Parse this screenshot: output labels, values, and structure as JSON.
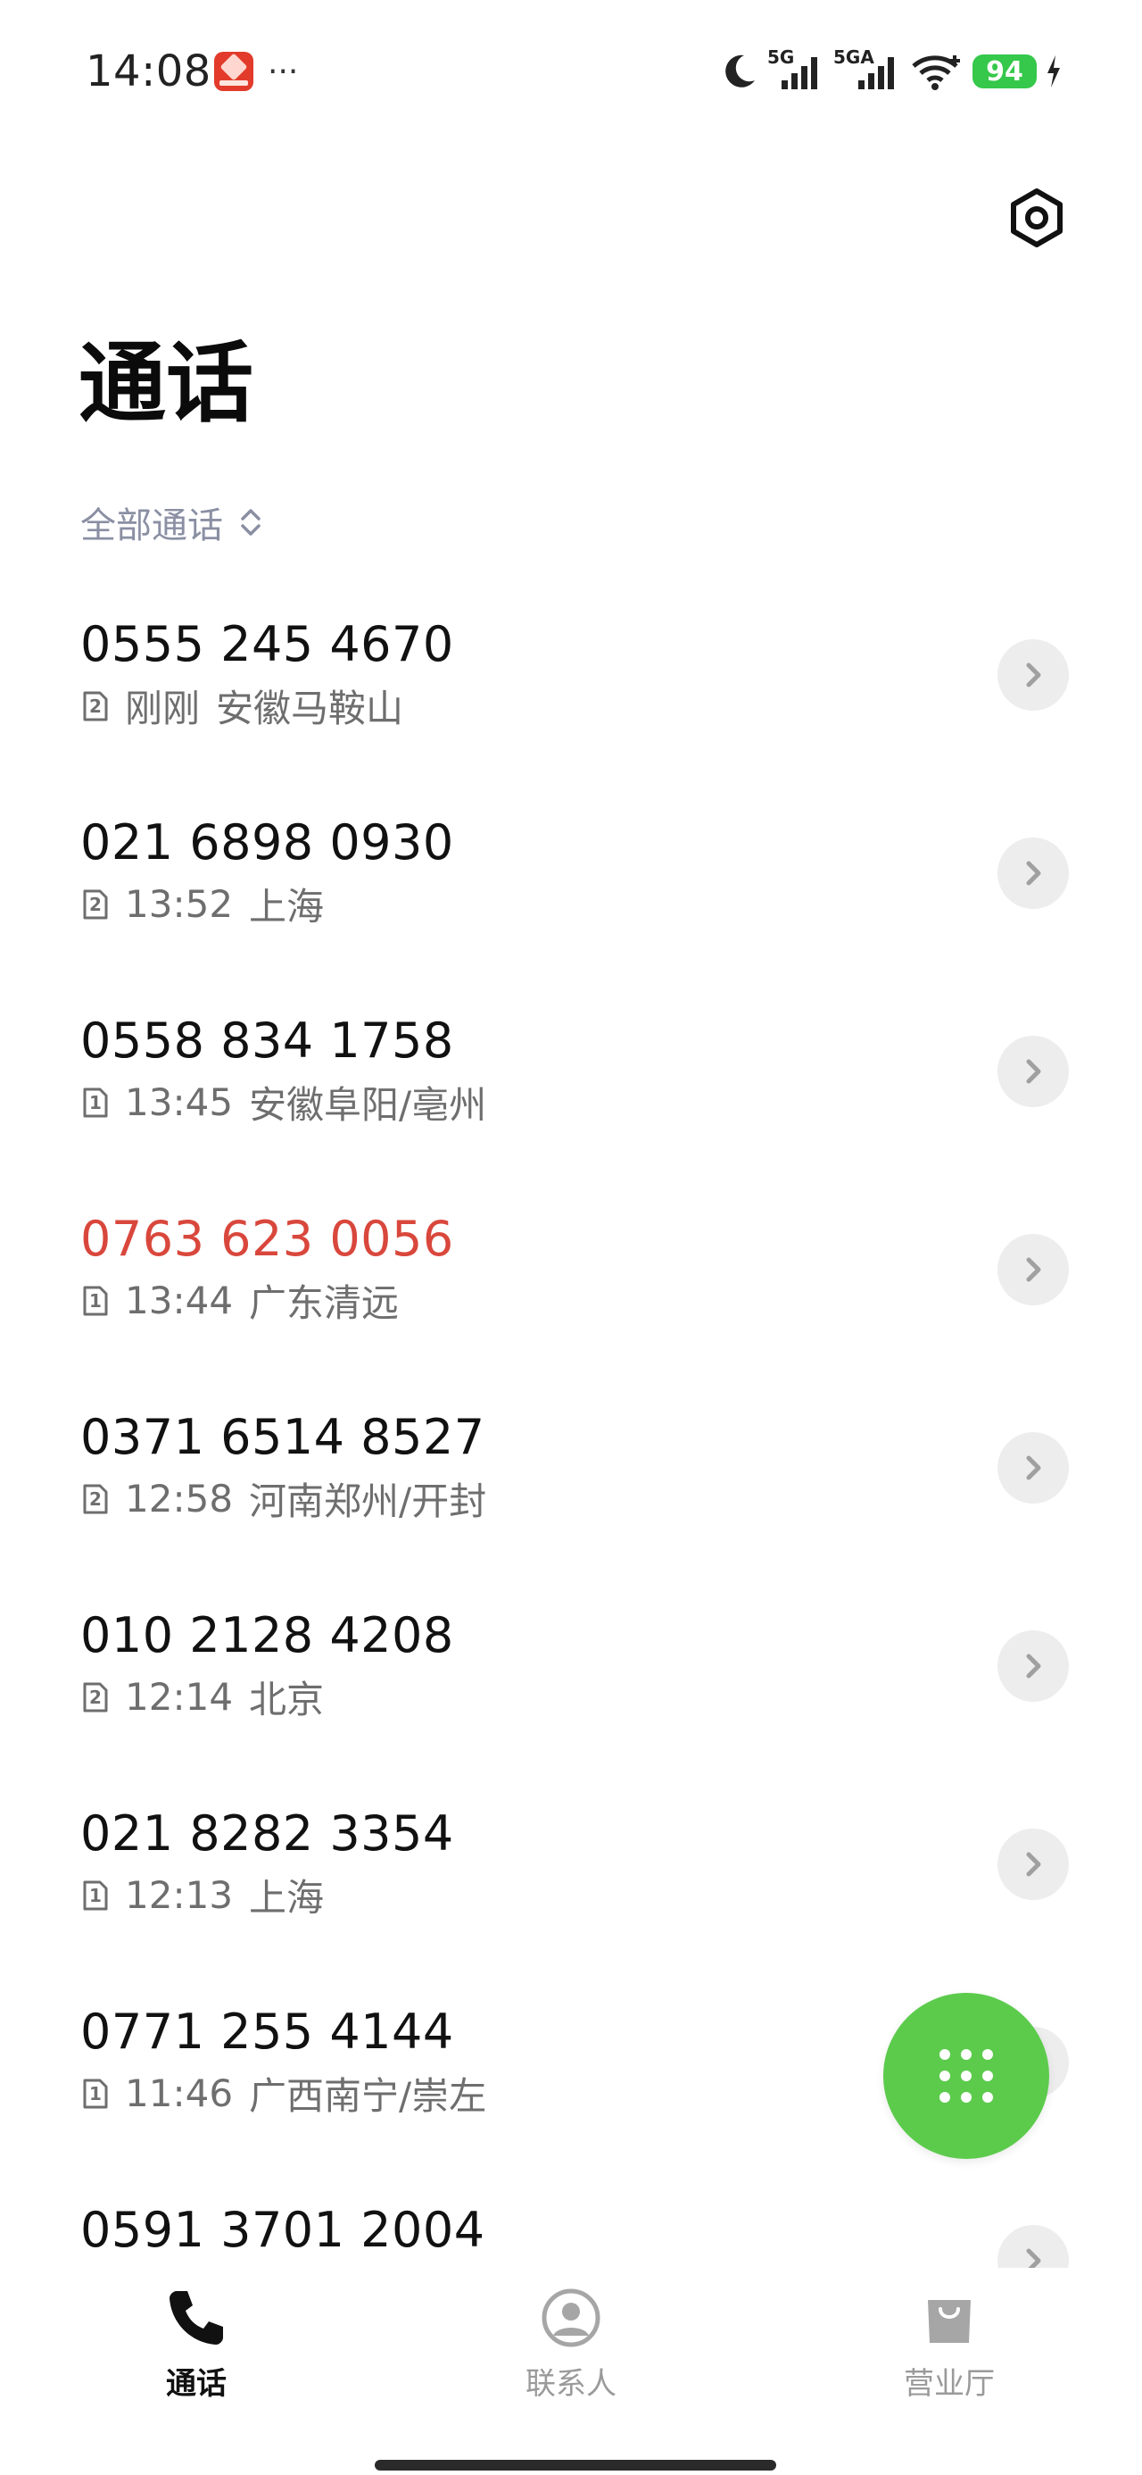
{
  "status_bar": {
    "time": "14:08",
    "more": "···",
    "net1": "5G",
    "net2": "5GA",
    "battery": "94",
    "colors": {
      "battery": "#35c84a"
    }
  },
  "header": {
    "title": "通话",
    "filter_label": "全部通话"
  },
  "calls": [
    {
      "number": "0555 245 4670",
      "sim": "2",
      "time": "刚刚",
      "location": "安徽马鞍山",
      "missed": false
    },
    {
      "number": "021 6898 0930",
      "sim": "2",
      "time": "13:52",
      "location": "上海",
      "missed": false
    },
    {
      "number": "0558 834 1758",
      "sim": "1",
      "time": "13:45",
      "location": "安徽阜阳/亳州",
      "missed": false
    },
    {
      "number": "0763 623 0056",
      "sim": "1",
      "time": "13:44",
      "location": "广东清远",
      "missed": true
    },
    {
      "number": "0371 6514 8527",
      "sim": "2",
      "time": "12:58",
      "location": "河南郑州/开封",
      "missed": false
    },
    {
      "number": "010 2128 4208",
      "sim": "2",
      "time": "12:14",
      "location": "北京",
      "missed": false
    },
    {
      "number": "021 8282 3354",
      "sim": "1",
      "time": "12:13",
      "location": "上海",
      "missed": false
    },
    {
      "number": "0771 255 4144",
      "sim": "1",
      "time": "11:46",
      "location": "广西南宁/崇左",
      "missed": false
    },
    {
      "number": "0591 3701 2004",
      "sim": "",
      "time": "",
      "location": "",
      "missed": false
    }
  ],
  "bottom_nav": {
    "calls": "通话",
    "contacts": "联系人",
    "store": "营业厅"
  },
  "colors": {
    "missed": "#d9473c",
    "fab": "#5ccb4c"
  }
}
